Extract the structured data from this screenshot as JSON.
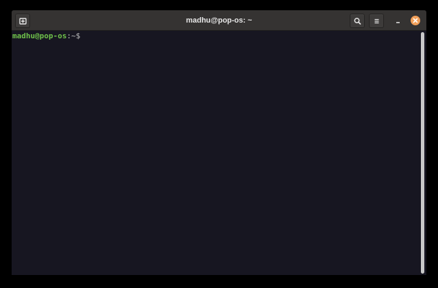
{
  "window": {
    "title": "madhu@pop-os: ~"
  },
  "titlebar": {
    "new_tab_icon": "new-tab-icon",
    "search_icon": "search-icon",
    "menu_icon": "hamburger-menu-icon",
    "minimize_icon": "minimize-icon",
    "close_icon": "close-icon",
    "close_color": "#f2a05a"
  },
  "terminal": {
    "prompt_user": "madhu@pop-os",
    "prompt_sep": ":",
    "prompt_path": "~",
    "prompt_symbol": "$",
    "user_color": "#6ec04a",
    "background": "#171621"
  }
}
